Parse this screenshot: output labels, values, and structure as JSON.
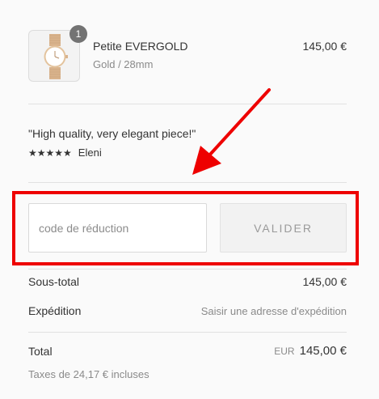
{
  "product": {
    "quantity": "1",
    "name": "Petite EVERGOLD",
    "variant": "Gold / 28mm",
    "price": "145,00 €"
  },
  "review": {
    "quote": "\"High quality, very elegant piece!\"",
    "stars": "★★★★★",
    "rating": 5,
    "author": "Eleni"
  },
  "discount": {
    "placeholder": "code de réduction",
    "apply_label": "VALIDER"
  },
  "summary": {
    "subtotal_label": "Sous-total",
    "subtotal_value": "145,00 €",
    "shipping_label": "Expédition",
    "shipping_value": "Saisir une adresse d'expédition",
    "total_label": "Total",
    "total_currency": "EUR",
    "total_value": "145,00 €",
    "tax_note": "Taxes de 24,17 € incluses"
  },
  "colors": {
    "annotation": "#ee0000",
    "badge": "#737373",
    "background": "#fafafa"
  }
}
